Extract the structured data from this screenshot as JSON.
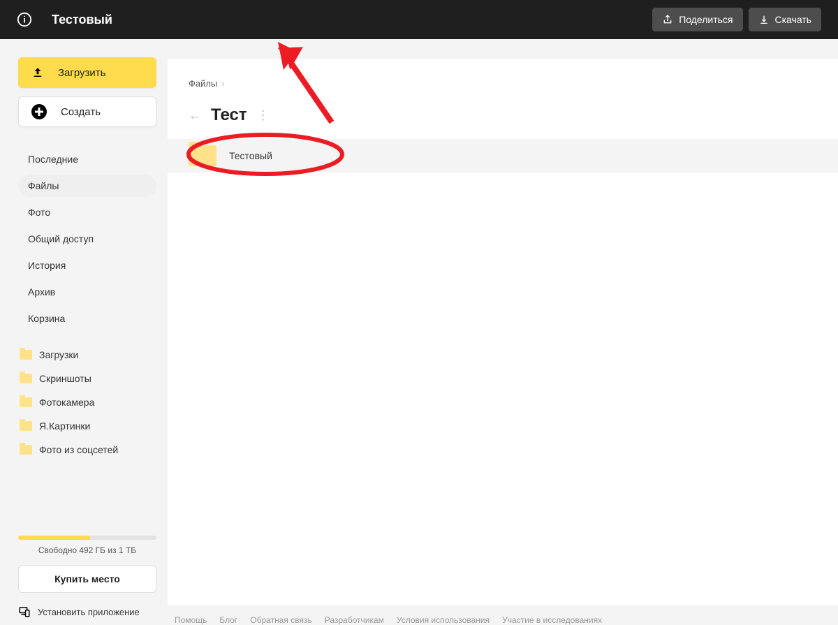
{
  "topbar": {
    "title": "Тестовый",
    "share_label": "Поделиться",
    "download_label": "Скачать"
  },
  "sidebar": {
    "upload_label": "Загрузить",
    "create_label": "Создать",
    "nav": [
      {
        "label": "Последние"
      },
      {
        "label": "Файлы"
      },
      {
        "label": "Фото"
      },
      {
        "label": "Общий доступ"
      },
      {
        "label": "История"
      },
      {
        "label": "Архив"
      },
      {
        "label": "Корзина"
      }
    ],
    "active_index": 1,
    "folders": [
      {
        "label": "Загрузки"
      },
      {
        "label": "Скриншоты"
      },
      {
        "label": "Фотокамера"
      },
      {
        "label": "Я.Картинки"
      },
      {
        "label": "Фото из соцсетей"
      }
    ],
    "storage_text": "Свободно 492 ГБ из 1 ТБ",
    "storage_fill_pct": 52,
    "buy_label": "Купить место",
    "install_label": "Установить приложение"
  },
  "main": {
    "breadcrumb_root": "Файлы",
    "heading": "Тест",
    "file_name": "Тестовый"
  },
  "footer": {
    "links": [
      "Помощь",
      "Блог",
      "Обратная связь",
      "Разработчикам",
      "Условия использования",
      "Участие в исследованиях"
    ]
  },
  "colors": {
    "accent": "#ffdb4d",
    "annotation": "#ed1c24"
  }
}
